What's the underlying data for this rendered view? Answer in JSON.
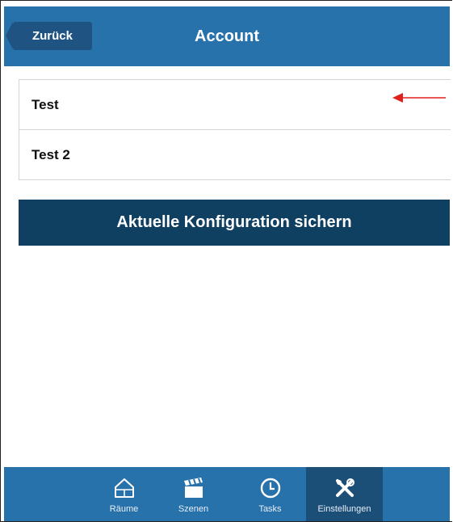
{
  "header": {
    "back_label": "Zurück",
    "title": "Account"
  },
  "accounts": [
    {
      "label": "Test"
    },
    {
      "label": "Test 2"
    }
  ],
  "save_button": {
    "label": "Aktuelle Konfiguration sichern"
  },
  "annotation": {
    "color": "#e0201c"
  },
  "tabbar": {
    "tabs": [
      {
        "label": "Räume",
        "icon": "house-icon",
        "active": false
      },
      {
        "label": "Szenen",
        "icon": "clapperboard-icon",
        "active": false
      },
      {
        "label": "Tasks",
        "icon": "clock-icon",
        "active": false
      },
      {
        "label": "Einstellungen",
        "icon": "tools-icon",
        "active": true
      }
    ]
  },
  "colors": {
    "header_bg": "#2872ab",
    "button_bg": "#0f3f61",
    "active_tab_bg": "#1c4f78"
  }
}
